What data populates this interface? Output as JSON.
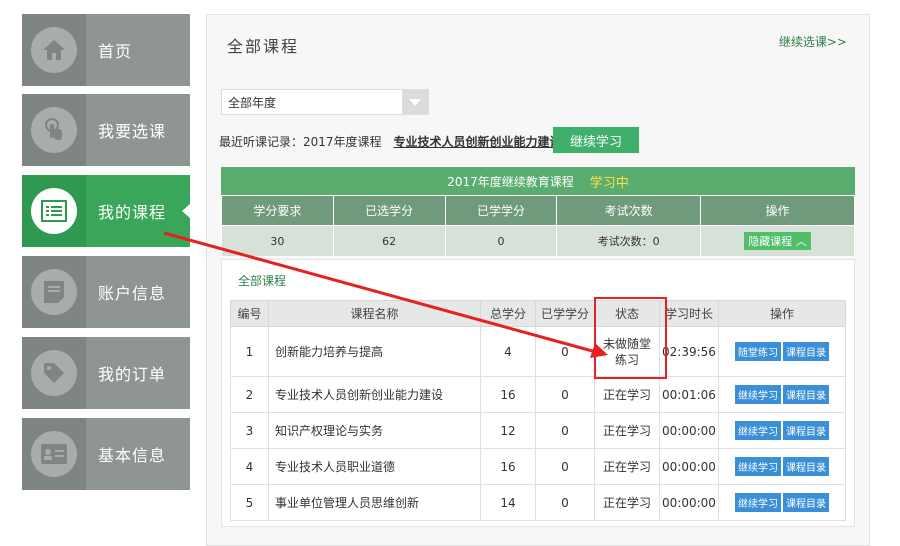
{
  "sidebar": {
    "items": [
      {
        "label": "首页",
        "icon": "home-icon",
        "active": false
      },
      {
        "label": "我要选课",
        "icon": "touch-icon",
        "active": false
      },
      {
        "label": "我的课程",
        "icon": "list-icon",
        "active": true
      },
      {
        "label": "账户信息",
        "icon": "document-icon",
        "active": false
      },
      {
        "label": "我的订单",
        "icon": "tag-icon",
        "active": false
      },
      {
        "label": "基本信息",
        "icon": "id-card-icon",
        "active": false
      }
    ]
  },
  "main": {
    "title": "全部课程",
    "continue_select": "继续选课>>",
    "year_select": {
      "value": "全部年度"
    },
    "recent": {
      "label": "最近听课记录：2017年度课程",
      "course": "专业技术人员创新创业能力建设",
      "continue_button": "继续学习"
    },
    "summary": {
      "program": "2017年度继续教育课程",
      "status": "学习中",
      "headers": [
        "学分要求",
        "已选学分",
        "已学学分",
        "考试次数",
        "操作"
      ],
      "row": [
        "30",
        "62",
        "0",
        "考试次数：0"
      ],
      "hide_button": "隐藏课程 ︿"
    },
    "courses": {
      "tab": "全部课程",
      "headers": [
        "编号",
        "课程名称",
        "总学分",
        "已学学分",
        "状态",
        "学习时长",
        "操作"
      ],
      "rows": [
        {
          "no": "1",
          "name": "创新能力培养与提高",
          "credit": "4",
          "learned": "0",
          "status": "未做随堂练习",
          "time": "02:39:56",
          "op1": "随堂练习",
          "op2": "课程目录"
        },
        {
          "no": "2",
          "name": "专业技术人员创新创业能力建设",
          "credit": "16",
          "learned": "0",
          "status": "正在学习",
          "time": "00:01:06",
          "op1": "继续学习",
          "op2": "课程目录"
        },
        {
          "no": "3",
          "name": "知识产权理论与实务",
          "credit": "12",
          "learned": "0",
          "status": "正在学习",
          "time": "00:00:00",
          "op1": "继续学习",
          "op2": "课程目录"
        },
        {
          "no": "4",
          "name": "专业技术人员职业道德",
          "credit": "16",
          "learned": "0",
          "status": "正在学习",
          "time": "00:00:00",
          "op1": "继续学习",
          "op2": "课程目录"
        },
        {
          "no": "5",
          "name": "事业单位管理人员思维创新",
          "credit": "14",
          "learned": "0",
          "status": "正在学习",
          "time": "00:00:00",
          "op1": "继续学习",
          "op2": "课程目录"
        }
      ]
    }
  },
  "colors": {
    "active_green": "#3aa65a",
    "nav_gray": "#8f9691",
    "summary_bar": "#5aac6f",
    "status_yellow": "#ffe14a",
    "op_blue": "#3a8fd6",
    "annotation_red": "#e52121"
  }
}
